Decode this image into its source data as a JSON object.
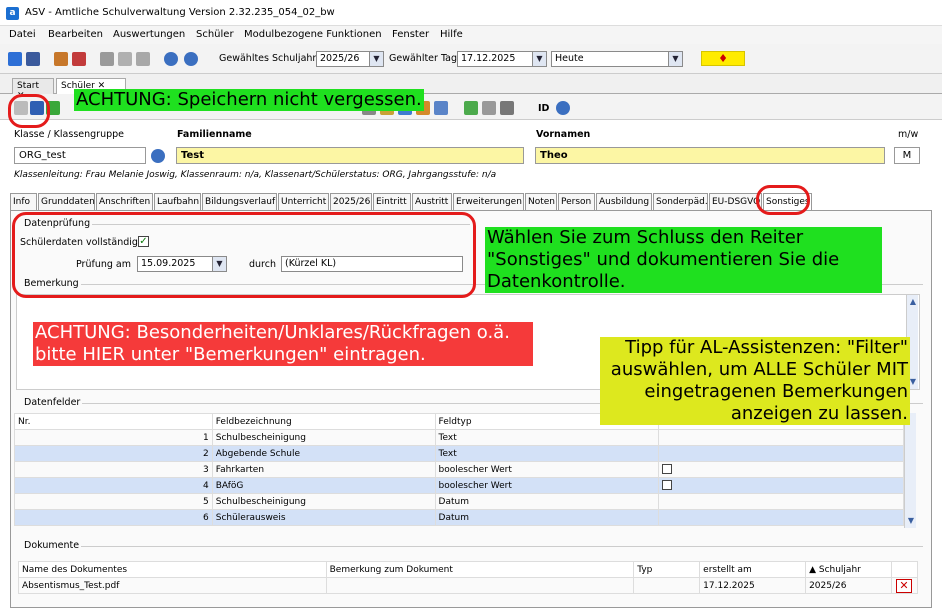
{
  "window": {
    "title": "ASV - Amtliche Schulverwaltung Version 2.32.235_054_02_bw",
    "app_icon": "a"
  },
  "menu": [
    "Datei",
    "Bearbeiten",
    "Auswertungen",
    "Schüler",
    "Modulbezogene Funktionen",
    "Fenster",
    "Hilfe"
  ],
  "toolbar": {
    "schuljahr_label": "Gewähltes Schuljahr",
    "schuljahr_value": "2025/26",
    "tag_label": "Gewählter Tag",
    "tag_value": "17.12.2025",
    "heute_value": "Heute"
  },
  "doc_tabs": [
    "Start",
    "Schüler"
  ],
  "toolbar2": {
    "id_label": "ID"
  },
  "header": {
    "klasse_label": "Klasse / Klassengruppe",
    "klasse_value": "ORG_test",
    "familienname_label": "Familienname",
    "familienname_value": "Test",
    "vornamen_label": "Vornamen",
    "vornamen_value": "Theo",
    "mw_label": "m/w",
    "mw_value": "M",
    "info_line": "Klassenleitung: Frau Melanie Joswig, Klassenraum: n/a, Klassenart/Schülerstatus: ORG, Jahrgangsstufe: n/a"
  },
  "tabs": [
    "Info",
    "Grunddaten",
    "Anschriften",
    "Laufbahn",
    "Bildungsverlauf",
    "Unterricht",
    "2025/26",
    "Eintritt",
    "Austritt",
    "Erweiterungen",
    "Noten",
    "Person",
    "Ausbildung",
    "Sonderpäd.",
    "EU-DSGVO",
    "Sonstiges"
  ],
  "datenpruefung": {
    "group_title": "Datenprüfung",
    "vollstaendig_label": "Schülerdaten vollständig",
    "vollstaendig_checked": true,
    "pruefung_label": "Prüfung am",
    "pruefung_value": "15.09.2025",
    "durch_label": "durch",
    "durch_value": "(Kürzel KL)"
  },
  "bemerkung": {
    "group_title": "Bemerkung"
  },
  "datenfelder": {
    "group_title": "Datenfelder",
    "columns": [
      "Nr.",
      "Feldbezeichnung",
      "Feldtyp"
    ],
    "rows": [
      {
        "nr": "1",
        "name": "Schulbescheinigung",
        "typ": "Text",
        "checkbox": false
      },
      {
        "nr": "2",
        "name": "Abgebende Schule",
        "typ": "Text",
        "checkbox": false
      },
      {
        "nr": "3",
        "name": "Fahrkarten",
        "typ": "boolescher Wert",
        "checkbox": true
      },
      {
        "nr": "4",
        "name": "BAföG",
        "typ": "boolescher Wert",
        "checkbox": true
      },
      {
        "nr": "5",
        "name": "Schulbescheinigung",
        "typ": "Datum",
        "checkbox": false
      },
      {
        "nr": "6",
        "name": "Schülerausweis",
        "typ": "Datum",
        "checkbox": false
      }
    ]
  },
  "dokumente": {
    "group_title": "Dokumente",
    "columns": [
      "Name des Dokumentes",
      "Bemerkung zum Dokument",
      "Typ",
      "erstellt am",
      "Schuljahr"
    ],
    "rows": [
      {
        "name": "Absentismus_Test.pdf",
        "bemerkung": "",
        "typ": "",
        "erstellt": "17.12.2025",
        "schuljahr": "2025/26"
      }
    ]
  },
  "annotations": {
    "save_note": "ACHTUNG: Speichern nicht vergessen.",
    "tab_note": "Wählen Sie zum Schluss den Reiter \"Sonstiges\" und dokumentieren Sie die Datenkontrolle.",
    "remark_note": "ACHTUNG: Besonderheiten/Unklares/Rückfragen o.ä. bitte HIER unter \"Bemerkungen\" eintragen.",
    "tip_note": "Tipp für AL-Assistenzen: \"Filter\" auswählen, um ALLE Schüler MIT eingetragenen Bemerkungen anzeigen zu lassen."
  },
  "colors": {
    "selected_row": "#d3e1f7",
    "name_field": "#fcf6a4",
    "green_note": "#1fe01f",
    "red_note": "#f53a3a",
    "yellow_note": "#dde81e",
    "ring": "#e41b1b"
  }
}
